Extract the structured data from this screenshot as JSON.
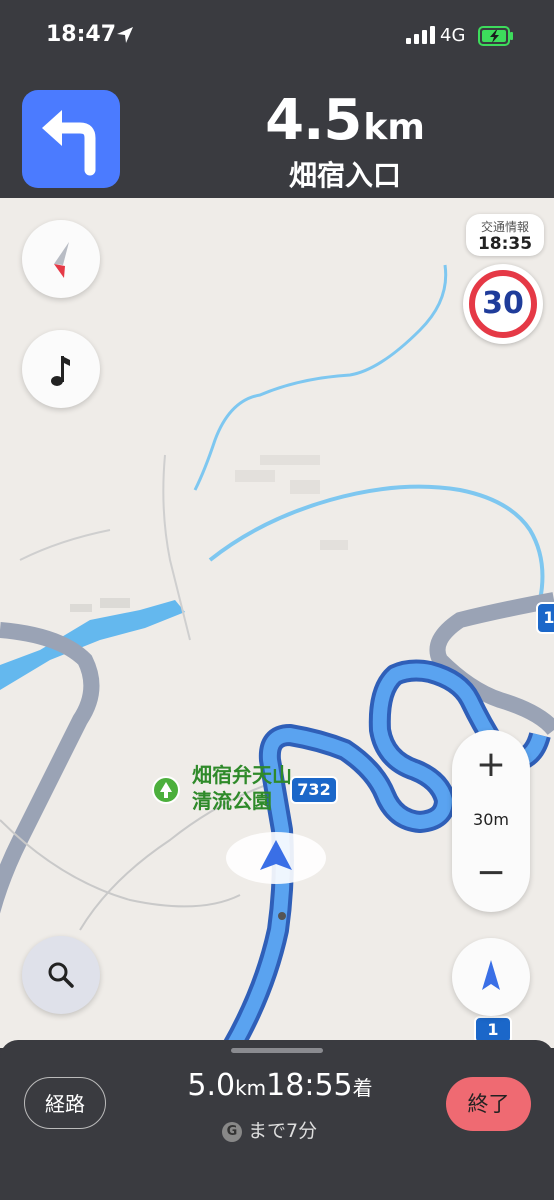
{
  "status": {
    "time": "18:47",
    "network": "4G"
  },
  "maneuver": {
    "distance": "4.5",
    "unit": "km",
    "street": "畑宿入口"
  },
  "traffic": {
    "label": "交通情報",
    "time": "18:35"
  },
  "speed_limit": "30",
  "poi": {
    "line1": "畑宿弁天山",
    "line2": "清流公園"
  },
  "road_shields": {
    "main": "732",
    "top_right": "1",
    "bottom": "1"
  },
  "zoom": {
    "plus": "+",
    "scale": "30m",
    "minus": "−"
  },
  "bottom_bar": {
    "route_label": "経路",
    "distance_value": "5.0",
    "distance_unit": "km",
    "arrival_time": "18:55",
    "arrival_suffix": "着",
    "eta_icon": "G",
    "time_remaining": "まで7分",
    "end_label": "終了"
  },
  "colors": {
    "accent": "#4b7bff",
    "route": "#4b8de8",
    "end": "#ef6a72",
    "poi": "#2f8a2a"
  },
  "icons": [
    "location-arrow-icon",
    "signal-icon",
    "battery-charging-icon",
    "turn-left-icon",
    "compass-icon",
    "music-note-icon",
    "search-icon",
    "tree-icon",
    "navigation-arrow-icon",
    "north-arrow-icon"
  ]
}
